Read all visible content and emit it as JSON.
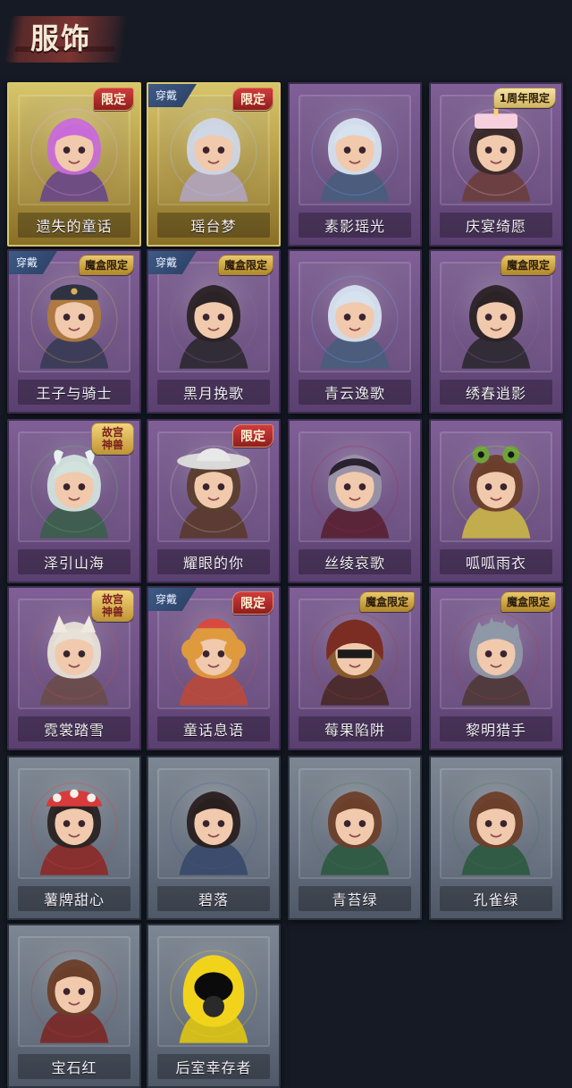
{
  "header": {
    "title": "服饰"
  },
  "cards": [
    {
      "name": "遗失的童话",
      "tag": "限定",
      "tag_kind": "limited",
      "worn": "",
      "style": "gold",
      "portrait": "pink-hair"
    },
    {
      "name": "瑶台梦",
      "tag": "限定",
      "tag_kind": "limited",
      "worn": "穿戴",
      "style": "gold",
      "portrait": "white-ornate"
    },
    {
      "name": "素影瑶光",
      "tag": "",
      "tag_kind": "",
      "worn": "",
      "style": "purple",
      "portrait": "silver-hair"
    },
    {
      "name": "庆宴绮愿",
      "tag": "1周年限定",
      "tag_kind": "anniv",
      "worn": "",
      "style": "purple",
      "portrait": "cake-hat"
    },
    {
      "name": "王子与骑士",
      "tag": "魔盒限定",
      "tag_kind": "box",
      "worn": "穿戴",
      "style": "purple",
      "portrait": "prince-hat"
    },
    {
      "name": "黑月挽歌",
      "tag": "魔盒限定",
      "tag_kind": "box",
      "worn": "穿戴",
      "style": "purple",
      "portrait": "dark-curls"
    },
    {
      "name": "青云逸歌",
      "tag": "",
      "tag_kind": "",
      "worn": "",
      "style": "purple",
      "portrait": "headband-silver"
    },
    {
      "name": "绣春逍影",
      "tag": "魔盒限定",
      "tag_kind": "box",
      "worn": "",
      "style": "purple",
      "portrait": "dark-wavy"
    },
    {
      "name": "泽引山海",
      "tag": "故宫\n神兽",
      "tag_kind": "palace",
      "worn": "",
      "style": "purple",
      "portrait": "horned-silver"
    },
    {
      "name": "耀眼的你",
      "tag": "限定",
      "tag_kind": "limited",
      "worn": "",
      "style": "purple",
      "portrait": "cowboy-hat"
    },
    {
      "name": "丝绫哀歌",
      "tag": "",
      "tag_kind": "",
      "worn": "",
      "style": "purple",
      "portrait": "lace-bonnet"
    },
    {
      "name": "呱呱雨衣",
      "tag": "",
      "tag_kind": "",
      "worn": "",
      "style": "purple",
      "portrait": "frog-hat"
    },
    {
      "name": "霓裳踏雪",
      "tag": "故宫\n神兽",
      "tag_kind": "palace",
      "worn": "",
      "style": "purple",
      "portrait": "fox-white"
    },
    {
      "name": "童话息语",
      "tag": "限定",
      "tag_kind": "limited",
      "worn": "穿戴",
      "style": "purple",
      "portrait": "orange-bun"
    },
    {
      "name": "莓果陷阱",
      "tag": "魔盒限定",
      "tag_kind": "box",
      "worn": "",
      "style": "purple",
      "portrait": "berry-hood"
    },
    {
      "name": "黎明猎手",
      "tag": "魔盒限定",
      "tag_kind": "box",
      "worn": "",
      "style": "purple",
      "portrait": "gray-spiky"
    },
    {
      "name": "薯牌甜心",
      "tag": "",
      "tag_kind": "",
      "worn": "",
      "style": "gray",
      "portrait": "mushroom-cap"
    },
    {
      "name": "碧落",
      "tag": "",
      "tag_kind": "",
      "worn": "",
      "style": "gray",
      "portrait": "curly-dark"
    },
    {
      "name": "青苔绿",
      "tag": "",
      "tag_kind": "",
      "worn": "",
      "style": "gray",
      "portrait": "brown-bob"
    },
    {
      "name": "孔雀绿",
      "tag": "",
      "tag_kind": "",
      "worn": "",
      "style": "gray",
      "portrait": "brown-bob-2"
    },
    {
      "name": "宝石红",
      "tag": "",
      "tag_kind": "",
      "worn": "",
      "style": "gray",
      "portrait": "brown-red"
    },
    {
      "name": "后室幸存者",
      "tag": "",
      "tag_kind": "",
      "worn": "",
      "style": "gray",
      "portrait": "hazmat"
    }
  ],
  "colors": {
    "background": "#151a24",
    "purple": "#6d4f84",
    "gold": "#b8a04a",
    "gray": "#667080",
    "limited_red": "#c33",
    "box_gold": "#d0ad4a"
  }
}
